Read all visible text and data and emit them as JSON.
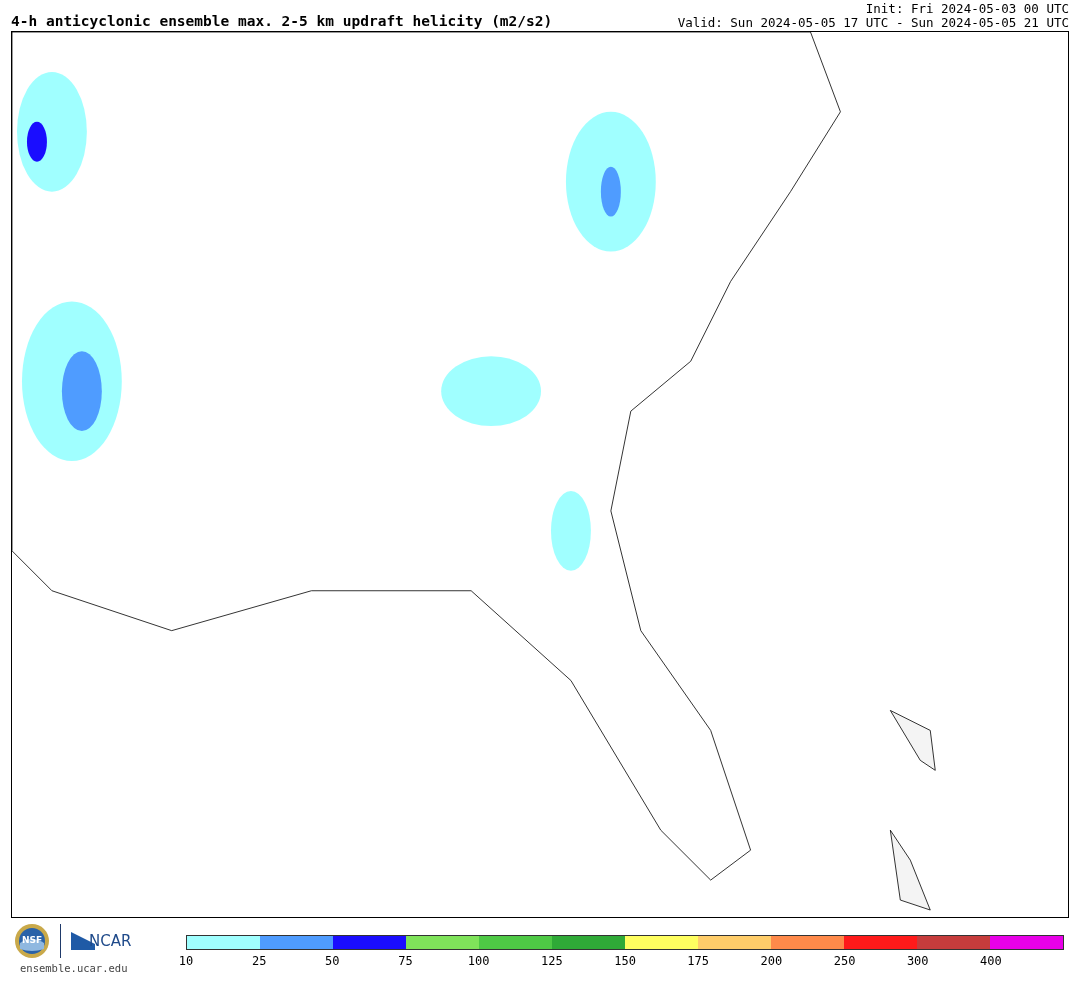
{
  "header": {
    "title": "4-h anticyclonic ensemble max. 2-5 km updraft helicity (m2/s2)",
    "init": "Init: Fri 2024-05-03 00 UTC",
    "valid": "Valid: Sun 2024-05-05 17 UTC - Sun 2024-05-05 21 UTC"
  },
  "footer": {
    "logo_left": "NSF",
    "logo_right": "NCAR",
    "site": "ensemble.ucar.edu"
  },
  "colorbar": [
    {
      "label": "10",
      "color": "#a0ffff"
    },
    {
      "label": "25",
      "color": "#4f9cff"
    },
    {
      "label": "50",
      "color": "#1a0dff"
    },
    {
      "label": "75",
      "color": "#7fe35a"
    },
    {
      "label": "100",
      "color": "#4ec945"
    },
    {
      "label": "125",
      "color": "#2faa37"
    },
    {
      "label": "150",
      "color": "#ffff60"
    },
    {
      "label": "175",
      "color": "#ffcd6a"
    },
    {
      "label": "200",
      "color": "#ff8a4a"
    },
    {
      "label": "250",
      "color": "#ff1a1a"
    },
    {
      "label": "300",
      "color": "#c63c3c"
    },
    {
      "label": "400",
      "color": "#e800e8"
    }
  ]
}
